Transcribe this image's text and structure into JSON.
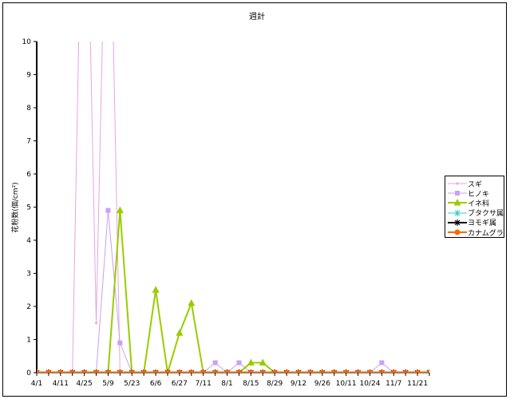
{
  "chart_data": {
    "type": "line",
    "title": "週計",
    "xlabel": "",
    "ylabel": "花粉数(個/cm²)",
    "ylim": [
      0,
      10
    ],
    "yticks": [
      0,
      1,
      2,
      3,
      4,
      5,
      6,
      7,
      8,
      9,
      10
    ],
    "x_tick_labels": [
      "4/1",
      "4/11",
      "4/25",
      "5/9",
      "5/23",
      "6/6",
      "6/27",
      "7/11",
      "8/1",
      "8/15",
      "8/29",
      "9/12",
      "9/26",
      "10/11",
      "10/24",
      "11/7",
      "11/21"
    ],
    "legend_position": "right",
    "grid": false,
    "series": [
      {
        "name": "スギ",
        "color": "#e9a3e0",
        "marker": "diamond-small",
        "values": [
          0,
          0,
          0,
          0,
          19,
          1.5,
          18,
          0,
          0,
          0,
          0,
          0,
          0,
          0,
          0,
          0,
          0,
          0,
          0,
          0,
          0,
          0,
          0,
          0,
          0,
          0,
          0,
          0,
          0,
          0,
          0,
          0,
          0,
          0
        ]
      },
      {
        "name": "ヒノキ",
        "color": "#c9a0f5",
        "marker": "square",
        "values": [
          0,
          0,
          0,
          0,
          0,
          0,
          4.9,
          0.9,
          0,
          0,
          0,
          0,
          0,
          0,
          0,
          0.3,
          0,
          0.3,
          0,
          0,
          0,
          0,
          0,
          0,
          0,
          0,
          0,
          0,
          0,
          0.3,
          0,
          0,
          0,
          0
        ]
      },
      {
        "name": "イネ科",
        "color": "#99cc00",
        "marker": "triangle",
        "values": [
          0,
          0,
          0,
          0,
          0,
          0,
          0,
          4.9,
          0,
          0,
          2.5,
          0,
          1.2,
          2.1,
          0,
          0,
          0,
          0,
          0.3,
          0.3,
          0,
          0,
          0,
          0,
          0,
          0,
          0,
          0,
          0,
          0,
          0,
          0,
          0,
          0
        ]
      },
      {
        "name": "ブタクサ属",
        "color": "#33cccc",
        "marker": "star",
        "values": [
          0,
          0,
          0,
          0,
          0,
          0,
          0,
          0,
          0,
          0,
          0,
          0,
          0,
          0,
          0,
          0,
          0,
          0,
          0,
          0,
          0,
          0,
          0,
          0,
          0,
          0,
          0,
          0,
          0,
          0,
          0,
          0,
          0,
          0
        ]
      },
      {
        "name": "ヨモギ属",
        "color": "#000000",
        "marker": "star",
        "values": [
          0,
          0,
          0,
          0,
          0,
          0,
          0,
          0,
          0,
          0,
          0,
          0,
          0,
          0,
          0,
          0,
          0,
          0,
          0,
          0,
          0,
          0,
          0,
          0,
          0,
          0,
          0,
          0,
          0,
          0,
          0,
          0,
          0,
          0
        ]
      },
      {
        "name": "カナムグラ",
        "color": "#ff6600",
        "marker": "circle",
        "values": [
          0,
          0,
          0,
          0,
          0,
          0,
          0,
          0,
          0,
          0,
          0,
          0,
          0,
          0,
          0,
          0,
          0,
          0,
          0,
          0,
          0,
          0,
          0,
          0,
          0,
          0,
          0,
          0,
          0,
          0,
          0,
          0,
          0,
          0
        ]
      }
    ]
  }
}
